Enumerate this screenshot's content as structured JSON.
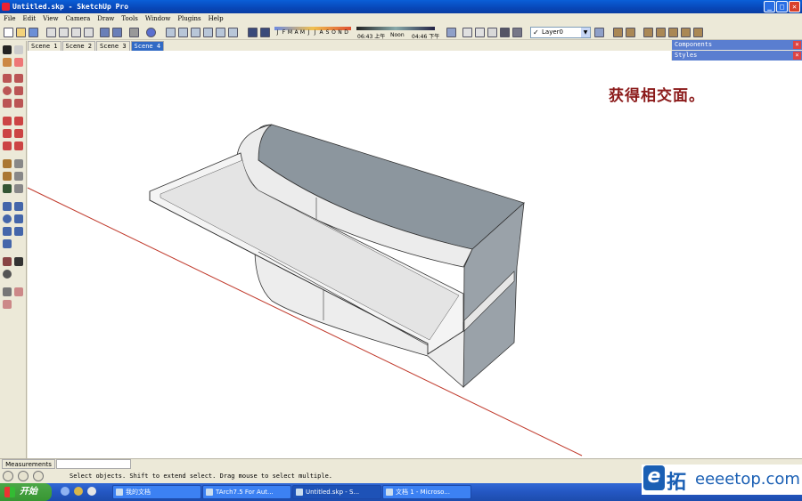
{
  "window": {
    "title": "Untitled.skp - SketchUp Pro",
    "controls": {
      "minimize": "_",
      "maximize": "□",
      "close": "✕"
    }
  },
  "menu": [
    "File",
    "Edit",
    "View",
    "Camera",
    "Draw",
    "Tools",
    "Window",
    "Plugins",
    "Help"
  ],
  "shadow": {
    "months": [
      "J",
      "F",
      "M",
      "A",
      "M",
      "J",
      "J",
      "A",
      "S",
      "O",
      "N",
      "D"
    ],
    "sunrise_time": "06:43 上午",
    "noon_label": "Noon",
    "sunset_time": "04:46 下午"
  },
  "layer": {
    "name": "Layer0",
    "checked": true
  },
  "scenes": [
    {
      "label": "Scene 1",
      "active": false
    },
    {
      "label": "Scene 2",
      "active": false
    },
    {
      "label": "Scene 3",
      "active": false
    },
    {
      "label": "Scene 4",
      "active": true
    }
  ],
  "annotation": "获得相交面。",
  "panels": [
    "Components",
    "Styles"
  ],
  "measurements": {
    "label": "Measurements",
    "value": ""
  },
  "status_text": "Select objects. Shift to extend select. Drag mouse to select multiple.",
  "taskbar": {
    "start_label": "开始",
    "tasks": [
      {
        "label": "我的文档",
        "active": false
      },
      {
        "label": "TArch7.5 For Aut...",
        "active": false
      },
      {
        "label": "Untitled.skp - S...",
        "active": true
      },
      {
        "label": "文档 1 - Microso...",
        "active": false
      }
    ]
  },
  "watermark": {
    "logo_letter": "e",
    "logo_char": "拓",
    "domain": "eeeetop.com"
  },
  "colors": {
    "titlebar": "#0a5fd8",
    "face_top": "#8c969e",
    "face_light": "#f2f2f2",
    "face_mid": "#e2e2e2",
    "red_axis": "#c0392b",
    "annotation": "#8b1a1a"
  }
}
